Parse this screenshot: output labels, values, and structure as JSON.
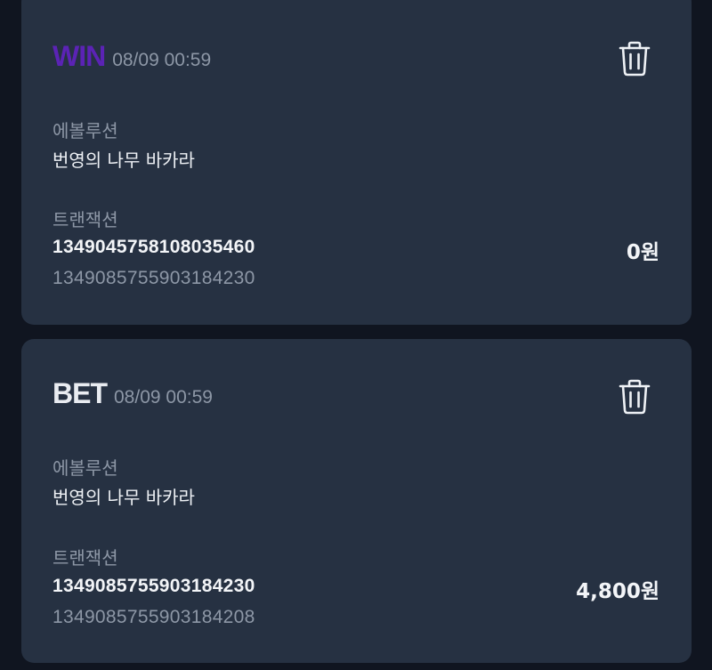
{
  "colors": {
    "win": "#5b23b5",
    "bet": "#e9ecf1",
    "card_bg": "#263142",
    "page_bg": "#101520"
  },
  "transactions": [
    {
      "type": "WIN",
      "date": "08/09 00:59",
      "provider_label": "에볼루션",
      "game": "번영의 나무 바카라",
      "transaction_label": "트랜잭션",
      "transaction_id": "1349045758108035460",
      "reference_id": "1349085755903184230",
      "amount": "0원",
      "delete_icon": "trash-icon"
    },
    {
      "type": "BET",
      "date": "08/09 00:59",
      "provider_label": "에볼루션",
      "game": "번영의 나무 바카라",
      "transaction_label": "트랜잭션",
      "transaction_id": "1349085755903184230",
      "reference_id": "1349085755903184208",
      "amount": "4,800원",
      "delete_icon": "trash-icon"
    }
  ]
}
